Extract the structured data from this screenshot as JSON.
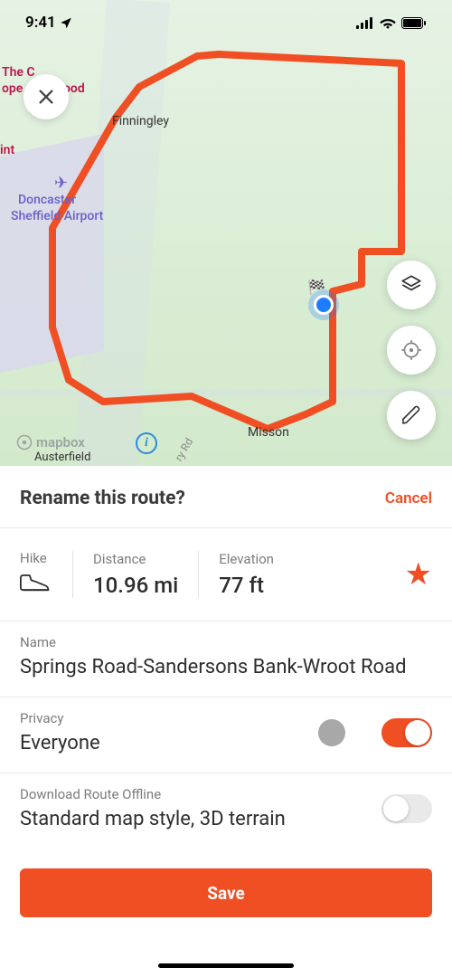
{
  "status": {
    "time": "9:41",
    "location_arrow": "➤"
  },
  "map": {
    "labels": {
      "finningley": "Finningley",
      "airport_l1": "Doncaster",
      "airport_l2": "Sheffield Airport",
      "misson": "Misson",
      "austerfield": "Austerfield",
      "poi_top1": "The C",
      "poi_top2": "ope",
      "poi_top3": "ood",
      "poi_left": "int",
      "road": "ry Rd"
    },
    "attribution": "mapbox",
    "info_char": "i"
  },
  "sheet": {
    "title": "Rename this route?",
    "cancel": "Cancel",
    "stats": {
      "hike_label": "Hike",
      "distance_label": "Distance",
      "distance_value": "10.96 mi",
      "elevation_label": "Elevation",
      "elevation_value": "77 ft"
    },
    "name_label": "Name",
    "name_value": "Springs Road-Sandersons Bank-Wroot Road",
    "privacy_label": "Privacy",
    "privacy_value": "Everyone",
    "download_label": "Download Route Offline",
    "download_value": "Standard map style, 3D terrain",
    "save": "Save"
  },
  "colors": {
    "accent": "#f04e23",
    "route": "#f04e23"
  }
}
